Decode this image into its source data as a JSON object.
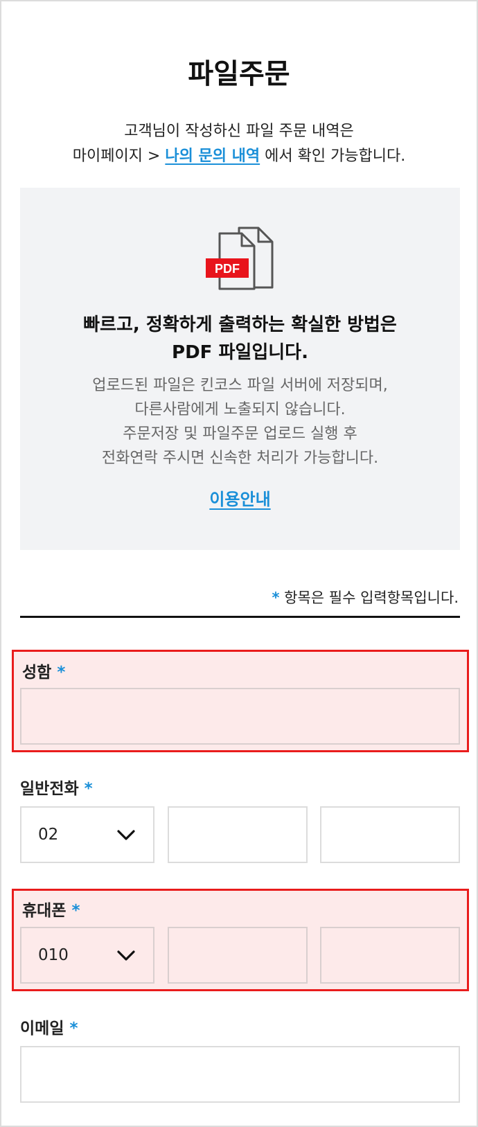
{
  "page": {
    "title": "파일주문",
    "intro_line1": "고객님이 작성하신 파일 주문 내역은",
    "intro_prefix": "마이페이지 > ",
    "intro_link": "나의 문의 내역",
    "intro_suffix": " 에서 확인 가능합니다."
  },
  "info": {
    "pdf_badge": "PDF",
    "heading_line1": "빠르고, 정확하게 출력하는 확실한 방법은",
    "heading_line2": "PDF 파일입니다.",
    "body_lines": [
      "업로드된 파일은 킨코스 파일 서버에 저장되며,",
      "다른사람에게 노출되지 않습니다.",
      "주문저장 및 파일주문 업로드 실행 후",
      "전화연락 주시면 신속한 처리가 가능합니다."
    ],
    "guide_link": "이용안내"
  },
  "form": {
    "required_star": "*",
    "required_note": " 항목은 필수 입력항목입니다.",
    "name": {
      "label": "성함",
      "value": ""
    },
    "phone": {
      "label": "일반전화",
      "area_code": "02",
      "middle": "",
      "last": ""
    },
    "mobile": {
      "label": "휴대폰",
      "prefix": "010",
      "middle": "",
      "last": ""
    },
    "email": {
      "label": "이메일",
      "value": ""
    }
  },
  "colors": {
    "accent": "#1a8fd8",
    "error_border": "#e91c1c",
    "error_bg": "#fdeaea",
    "pdf_red": "#e8141c"
  },
  "icons": {
    "pdf": "pdf-file-icon",
    "chevron": "chevron-down-icon"
  }
}
